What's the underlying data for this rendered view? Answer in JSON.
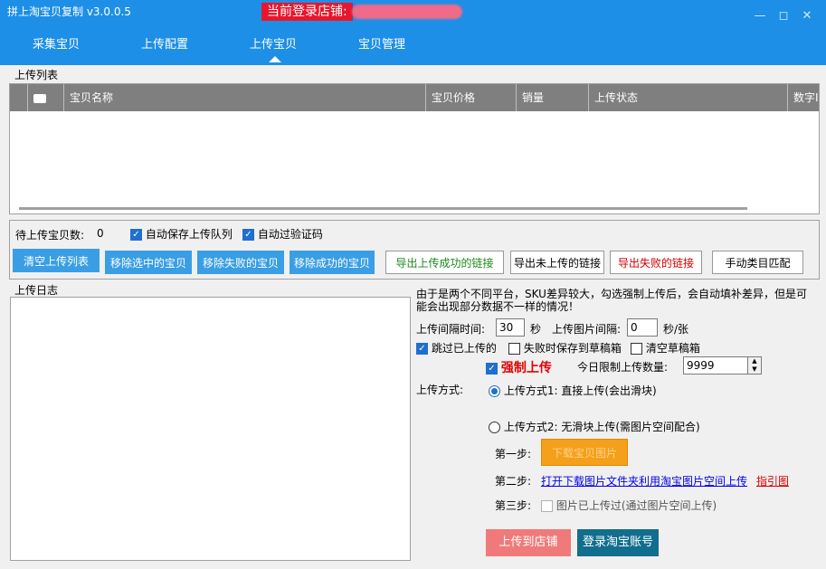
{
  "window": {
    "title": "拼上淘宝贝复制 v3.0.0.5",
    "store_label": "当前登录店铺:"
  },
  "tabs": [
    {
      "label": "采集宝贝"
    },
    {
      "label": "上传配置"
    },
    {
      "label": "上传宝贝",
      "active": true
    },
    {
      "label": "宝贝管理"
    }
  ],
  "upload_list": {
    "title": "上传列表",
    "columns": [
      "宝贝名称",
      "宝贝价格",
      "销量",
      "上传状态",
      "数字I"
    ]
  },
  "ops": {
    "pending_label": "待上传宝贝数:",
    "pending_count": "0",
    "auto_save_queue": "自动保存上传队列",
    "auto_captcha": "自动过验证码",
    "buttons": {
      "clear_list": "清空上传列表",
      "remove_selected": "移除选中的宝贝",
      "remove_failed": "移除失败的宝贝",
      "remove_success": "移除成功的宝贝",
      "export_success": "导出上传成功的链接",
      "export_unuploaded": "导出未上传的链接",
      "export_failed": "导出失败的链接",
      "manual_category": "手动类目匹配"
    }
  },
  "log": {
    "title": "上传日志"
  },
  "settings": {
    "note": "由于是两个不同平台，SKU差异较大，勾选强制上传后，会自动填补差异，但是可能会出现部分数据不一样的情况！",
    "interval_label": "上传间隔时间:",
    "interval_value": "30",
    "interval_unit": "秒",
    "img_interval_label": "上传图片间隔:",
    "img_interval_value": "0",
    "img_interval_unit": "秒/张",
    "skip_uploaded": "跳过已上传的",
    "save_draft_on_fail": "失败时保存到草稿箱",
    "clear_drafts": "清空草稿箱",
    "force_upload": "强制上传",
    "daily_limit_label": "今日限制上传数量:",
    "daily_limit_value": "9999",
    "mode_label": "上传方式:",
    "mode1": "上传方式1: 直接上传(会出滑块)",
    "mode2": "上传方式2: 无滑块上传(需图片空间配合)",
    "step1_label": "第一步:",
    "step1_button": "下载宝贝图片",
    "step2_label": "第二步:",
    "step2_link": "打开下载图片文件夹利用淘宝图片空间上传",
    "guide_link": "指引图",
    "step3_label": "第三步:",
    "step3_check": "图片已上传过(通过图片空间上传)",
    "upload_button": "上传到店铺",
    "login_button": "登录淘宝账号"
  },
  "colors": {
    "titlebar": "#1e8fe6",
    "store_label_bg": "#e8162d",
    "step1_bg": "#f5a01a",
    "upload_btn": "#f07a7a",
    "login_btn": "#126e8f"
  }
}
